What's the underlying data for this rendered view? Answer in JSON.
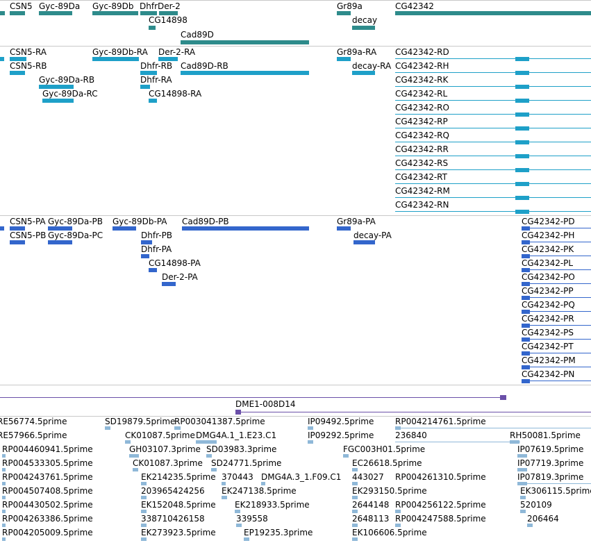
{
  "colors": {
    "gene": "#2e8b8b",
    "transcript": "#1ea0c8",
    "protein": "#3366cc",
    "clone": "#6a4fa8",
    "est": "#8fb8d8",
    "separator": "#c8c8c8"
  },
  "genes": {
    "labels": [
      "CSN5",
      "Gyc-89Da",
      "Gyc-89Db",
      "DhfrDer-2",
      "CG14898",
      "Cad89D",
      "Gr89a",
      "decay",
      "CG42342"
    ]
  },
  "transcripts": {
    "labels": [
      "CSN5-RA",
      "CSN5-RB",
      "Gyc-89Da-RB",
      "Gyc-89Da-RC",
      "Gyc-89Db-RA",
      "Der-2-RA",
      "Dhfr-RB",
      "Cad89D-RB",
      "Dhfr-RA",
      "CG14898-RA",
      "Gr89a-RA",
      "decay-RA"
    ],
    "cg42342": [
      "CG42342-RD",
      "CG42342-RH",
      "CG42342-RK",
      "CG42342-RL",
      "CG42342-RO",
      "CG42342-RP",
      "CG42342-RQ",
      "CG42342-RR",
      "CG42342-RS",
      "CG42342-RT",
      "CG42342-RM",
      "CG42342-RN"
    ]
  },
  "proteins": {
    "labels": [
      "CSN5-PA",
      "Gyc-89Da-PB",
      "CSN5-PB",
      "Gyc-89Da-PC",
      "Gyc-89Db-PA",
      "Cad89D-PB",
      "Dhfr-PB",
      "Dhfr-PA",
      "CG14898-PA",
      "Der-2-PA",
      "Gr89a-PA",
      "decay-PA"
    ],
    "cg42342": [
      "CG42342-PD",
      "CG42342-PH",
      "CG42342-PK",
      "CG42342-PL",
      "CG42342-PO",
      "CG42342-PP",
      "CG42342-PQ",
      "CG42342-PR",
      "CG42342-PS",
      "CG42342-PT",
      "CG42342-PM",
      "CG42342-PN"
    ]
  },
  "clone": {
    "label": "DME1-008D14"
  },
  "ests": {
    "labels": [
      "RE56774.5prime",
      "SD19879.5prime",
      "RP003041387.5prime",
      "IP09492.5prime",
      "RP004214761.5prime",
      "RE57966.5prime",
      "CK01087.5prime",
      "DMG4A.1_1.E23.C1",
      "IP09292.5prime",
      "236840",
      "RH50081.5prime",
      "RP004460941.5prime",
      "GH03107.3prime",
      "SD03983.3prime",
      "FGC003H01.5prime",
      "IP07619.5prime",
      "RP004533305.5prime",
      "CK01087.3prime",
      "SD24771.5prime",
      "EC26618.5prime",
      "IP07719.3prime",
      "RP004243761.5prime",
      "EK214235.5prime",
      "370443",
      "DMG4A.3_1.F09.C1",
      "443027",
      "RP004261310.5prime",
      "IP07819.3prime",
      "RP004507408.5prime",
      "203965424256",
      "EK247138.5prime",
      "EK293150.5prime",
      "EK306115.5prime",
      "RP004430502.5prime",
      "EK152048.5prime",
      "EK218933.5prime",
      "2644148",
      "RP004256122.5prime",
      "520109",
      "RP004263386.5prime",
      "338710426158",
      "339558",
      "2648113",
      "RP004247588.5prime",
      "206464",
      "RP004205009.5prime",
      "EK273923.5prime",
      "EP19235.3prime",
      "EK106606.5prime"
    ]
  }
}
